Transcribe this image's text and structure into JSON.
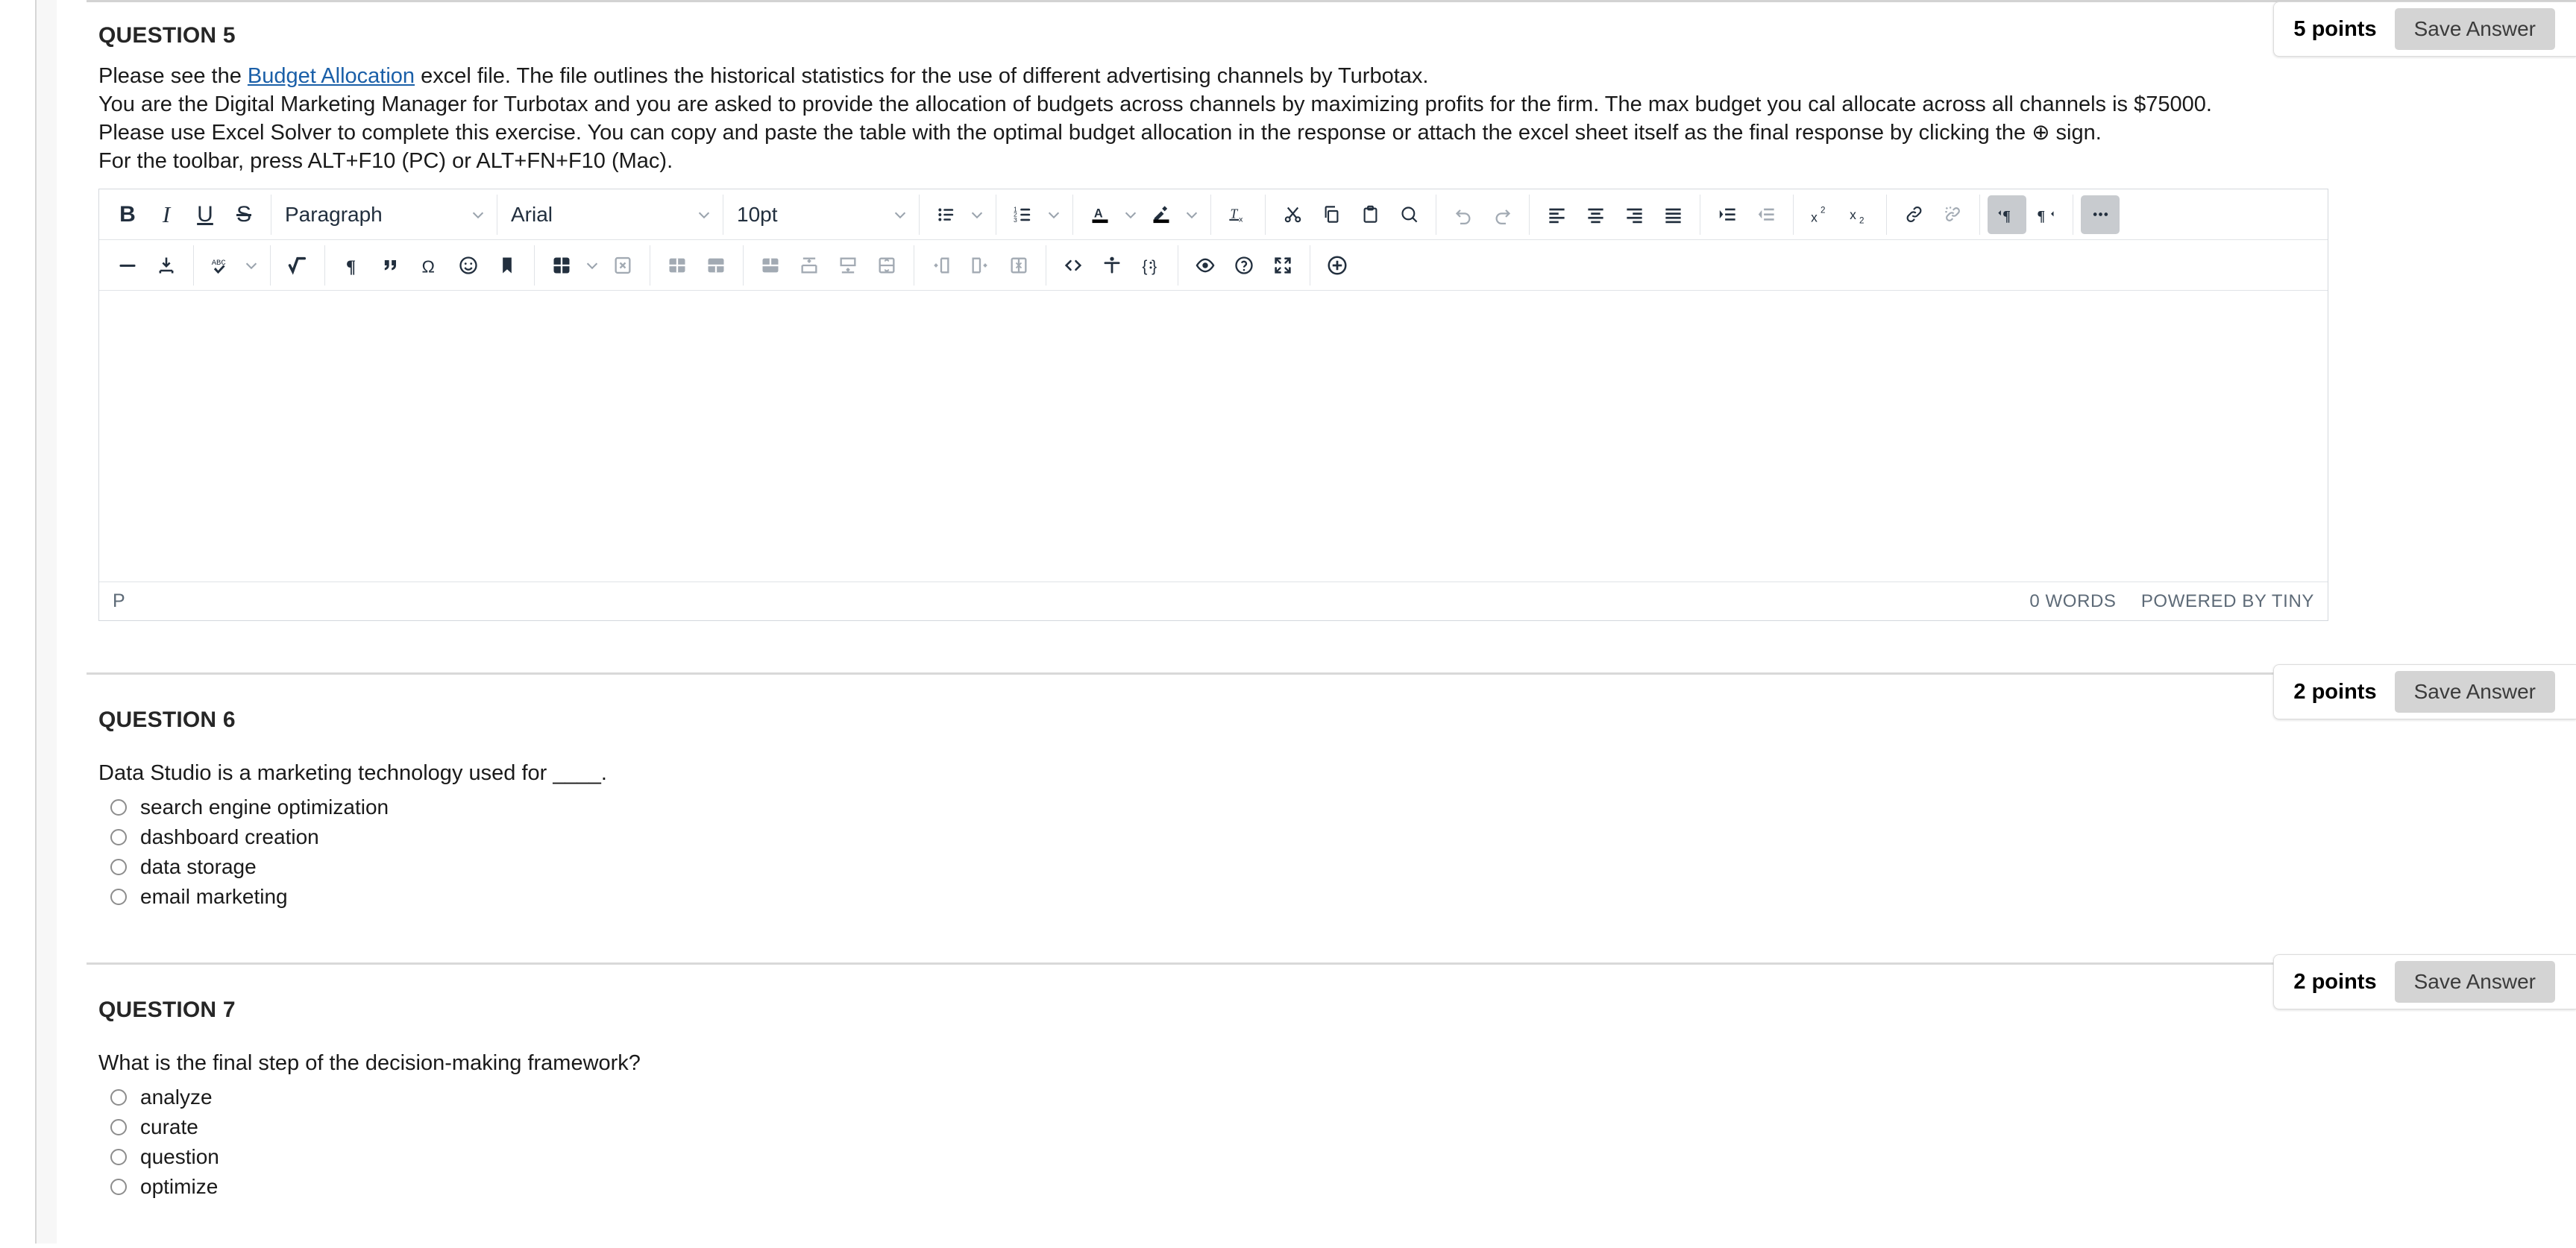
{
  "questions": [
    {
      "header": "QUESTION 5",
      "points": "5 points",
      "save_label": "Save Answer",
      "lines": [
        {
          "pre": "Please see the ",
          "link": "Budget Allocation",
          "post": " excel file. The file outlines the historical statistics for the use of different advertising channels by Turbotax."
        },
        {
          "pre": "You are the Digital Marketing Manager for Turbotax and you are asked to provide the allocation of budgets across channels by maximizing profits for the firm. The max budget you cal allocate across all channels is $75000.",
          "link": "",
          "post": ""
        },
        {
          "pre": "Please use Excel Solver to complete this exercise. You can copy and paste the table with the optimal budget allocation in the response or attach the excel sheet itself as the final response by clicking the ⊕ sign.",
          "link": "",
          "post": ""
        },
        {
          "pre": "For the toolbar, press ALT+F10 (PC) or ALT+FN+F10 (Mac).",
          "link": "",
          "post": ""
        }
      ]
    },
    {
      "header": "QUESTION 6",
      "points": "2 points",
      "save_label": "Save Answer",
      "prompt": "Data Studio is a marketing technology used for ____.",
      "options": [
        "search engine optimization",
        "dashboard creation",
        "data storage",
        "email marketing"
      ]
    },
    {
      "header": "QUESTION 7",
      "points": "2 points",
      "save_label": "Save Answer",
      "prompt": "What is the final step of the decision-making framework?",
      "options": [
        "analyze",
        "curate",
        "question",
        "optimize"
      ]
    }
  ],
  "editor": {
    "selects": {
      "block_format": "Paragraph",
      "font_family": "Arial",
      "font_size": "10pt"
    },
    "row1": [
      {
        "name": "bold-button",
        "label": "B",
        "kind": "text-bold"
      },
      {
        "name": "italic-button",
        "label": "I",
        "kind": "text-ital"
      },
      {
        "name": "underline-button",
        "label": "U",
        "kind": "text-und"
      },
      {
        "name": "strikethrough-button",
        "label": "S",
        "kind": "text-strike"
      },
      {
        "name": "bullet-list-button",
        "label": "",
        "kind": "icon"
      },
      {
        "name": "numbered-list-button",
        "label": "",
        "kind": "icon"
      },
      {
        "name": "text-color-button",
        "label": "A",
        "kind": "icon"
      },
      {
        "name": "background-color-button",
        "label": "",
        "kind": "icon"
      },
      {
        "name": "clear-formatting-button",
        "label": "",
        "kind": "icon"
      },
      {
        "name": "cut-button",
        "label": "",
        "kind": "icon"
      },
      {
        "name": "copy-button",
        "label": "",
        "kind": "icon"
      },
      {
        "name": "paste-button",
        "label": "",
        "kind": "icon"
      },
      {
        "name": "search-replace-button",
        "label": "",
        "kind": "icon"
      },
      {
        "name": "undo-button",
        "label": "",
        "kind": "icon"
      },
      {
        "name": "redo-button",
        "label": "",
        "kind": "icon"
      },
      {
        "name": "align-left-button",
        "label": "",
        "kind": "icon"
      },
      {
        "name": "align-center-button",
        "label": "",
        "kind": "icon"
      },
      {
        "name": "align-right-button",
        "label": "",
        "kind": "icon"
      },
      {
        "name": "align-justify-button",
        "label": "",
        "kind": "icon"
      },
      {
        "name": "indent-button",
        "label": "",
        "kind": "icon"
      },
      {
        "name": "outdent-button",
        "label": "",
        "kind": "icon"
      },
      {
        "name": "superscript-button",
        "label": "",
        "kind": "icon"
      },
      {
        "name": "subscript-button",
        "label": "",
        "kind": "icon"
      },
      {
        "name": "insert-link-button",
        "label": "",
        "kind": "icon"
      },
      {
        "name": "remove-link-button",
        "label": "",
        "kind": "icon"
      },
      {
        "name": "ltr-direction-button",
        "label": "",
        "kind": "icon"
      },
      {
        "name": "rtl-direction-button",
        "label": "",
        "kind": "icon"
      },
      {
        "name": "more-options-button",
        "label": "",
        "kind": "icon"
      }
    ],
    "row2": [
      {
        "name": "horizontal-rule-button"
      },
      {
        "name": "page-break-button"
      },
      {
        "name": "spellcheck-button"
      },
      {
        "name": "math-equation-button"
      },
      {
        "name": "paragraph-mark-button"
      },
      {
        "name": "blockquote-button"
      },
      {
        "name": "special-character-button"
      },
      {
        "name": "emoticons-button"
      },
      {
        "name": "bookmark-button"
      },
      {
        "name": "insert-table-button"
      },
      {
        "name": "delete-table-button"
      },
      {
        "name": "table-row-properties-button"
      },
      {
        "name": "table-cell-properties-button"
      },
      {
        "name": "merge-cells-button"
      },
      {
        "name": "insert-row-above-button"
      },
      {
        "name": "insert-row-below-button"
      },
      {
        "name": "delete-row-button"
      },
      {
        "name": "insert-column-before-button"
      },
      {
        "name": "insert-column-after-button"
      },
      {
        "name": "delete-column-button"
      },
      {
        "name": "source-code-button"
      },
      {
        "name": "accessibility-checker-button"
      },
      {
        "name": "code-sample-button"
      },
      {
        "name": "preview-button"
      },
      {
        "name": "help-button"
      },
      {
        "name": "fullscreen-button"
      },
      {
        "name": "add-attachment-button"
      }
    ],
    "status": {
      "path": "P",
      "word_count": "0 WORDS",
      "branding": "POWERED BY TINY"
    }
  },
  "colors": {
    "link": "#1a5fa8",
    "toolbar_icon": "#222f3e",
    "toolbar_icon_dim": "#a2aab3",
    "active_button_bg": "#c8cbcf",
    "save_button_bg": "#d4d4d4",
    "rule": "#d3d3d3"
  }
}
